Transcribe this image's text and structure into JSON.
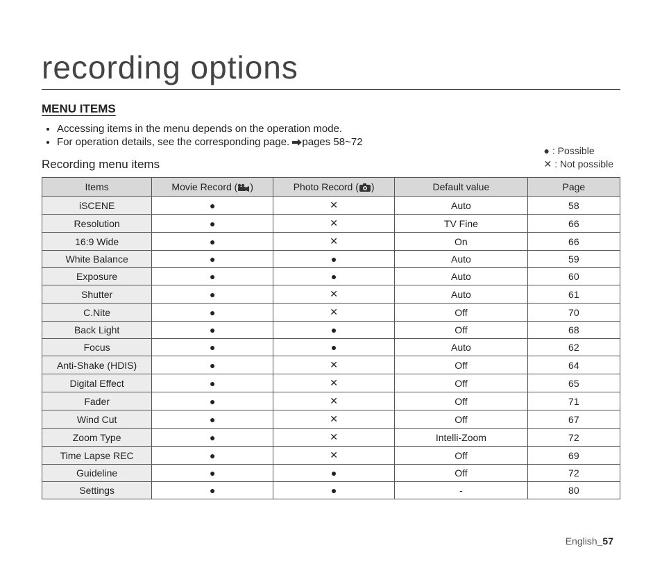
{
  "title": "recording options",
  "section_heading": "MENU ITEMS",
  "bullets": [
    "Accessing items in the menu depends on the operation mode.",
    "For operation details, see the corresponding page. "
  ],
  "bullet2_ref": "pages 58~72",
  "subheading": "Recording menu items",
  "legend": {
    "possible": " : Possible",
    "not_possible": " : Not possible"
  },
  "symbols": {
    "dot": "●",
    "cross": "✕"
  },
  "headers": {
    "items": "Items",
    "movie_pre": "Movie Record (",
    "movie_post": ")",
    "photo_pre": "Photo Record (",
    "photo_post": ")",
    "default": "Default value",
    "page": "Page"
  },
  "rows": [
    {
      "item": "iSCENE",
      "movie": "dot",
      "photo": "cross",
      "default": "Auto",
      "page": "58"
    },
    {
      "item": "Resolution",
      "movie": "dot",
      "photo": "cross",
      "default": "TV Fine",
      "page": "66"
    },
    {
      "item": "16:9 Wide",
      "movie": "dot",
      "photo": "cross",
      "default": "On",
      "page": "66"
    },
    {
      "item": "White Balance",
      "movie": "dot",
      "photo": "dot",
      "default": "Auto",
      "page": "59"
    },
    {
      "item": "Exposure",
      "movie": "dot",
      "photo": "dot",
      "default": "Auto",
      "page": "60"
    },
    {
      "item": "Shutter",
      "movie": "dot",
      "photo": "cross",
      "default": "Auto",
      "page": "61"
    },
    {
      "item": "C.Nite",
      "movie": "dot",
      "photo": "cross",
      "default": "Off",
      "page": "70"
    },
    {
      "item": "Back Light",
      "movie": "dot",
      "photo": "dot",
      "default": "Off",
      "page": "68"
    },
    {
      "item": "Focus",
      "movie": "dot",
      "photo": "dot",
      "default": "Auto",
      "page": "62"
    },
    {
      "item": "Anti-Shake (HDIS)",
      "movie": "dot",
      "photo": "cross",
      "default": "Off",
      "page": "64"
    },
    {
      "item": "Digital Effect",
      "movie": "dot",
      "photo": "cross",
      "default": "Off",
      "page": "65"
    },
    {
      "item": "Fader",
      "movie": "dot",
      "photo": "cross",
      "default": "Off",
      "page": "71"
    },
    {
      "item": "Wind Cut",
      "movie": "dot",
      "photo": "cross",
      "default": "Off",
      "page": "67"
    },
    {
      "item": "Zoom Type",
      "movie": "dot",
      "photo": "cross",
      "default": "Intelli-Zoom",
      "page": "72"
    },
    {
      "item": "Time Lapse REC",
      "movie": "dot",
      "photo": "cross",
      "default": "Off",
      "page": "69"
    },
    {
      "item": "Guideline",
      "movie": "dot",
      "photo": "dot",
      "default": "Off",
      "page": "72"
    },
    {
      "item": "Settings",
      "movie": "dot",
      "photo": "dot",
      "default": "-",
      "page": "80"
    }
  ],
  "footer": {
    "lang": "English",
    "sep": "_",
    "page": "57"
  }
}
